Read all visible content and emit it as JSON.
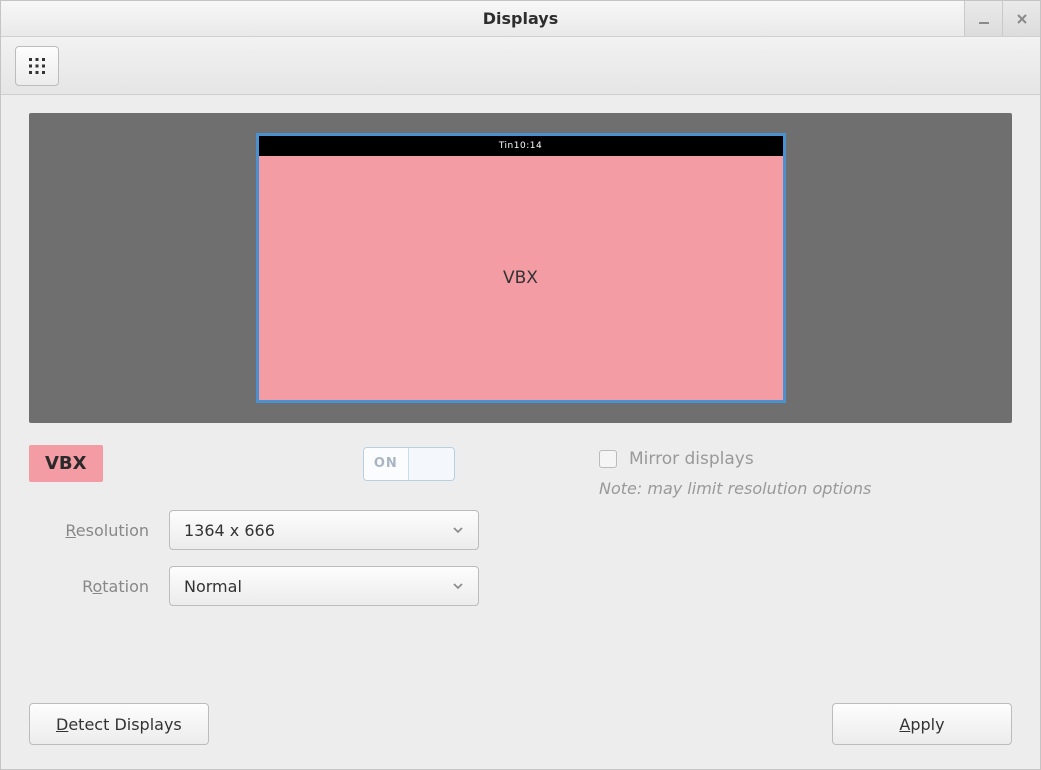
{
  "window": {
    "title": "Displays"
  },
  "preview": {
    "top_label": "Tin10:14",
    "display_name": "VBX"
  },
  "badge": {
    "label": "VBX"
  },
  "toggle": {
    "label": "ON"
  },
  "form": {
    "resolution_label": "Resolution",
    "resolution_value": "1364 x 666",
    "rotation_label": "Rotation",
    "rotation_value": "Normal"
  },
  "mirror": {
    "label": "Mirror displays",
    "note": "Note: may limit resolution options"
  },
  "footer": {
    "detect": "Detect Displays",
    "apply": "Apply"
  }
}
